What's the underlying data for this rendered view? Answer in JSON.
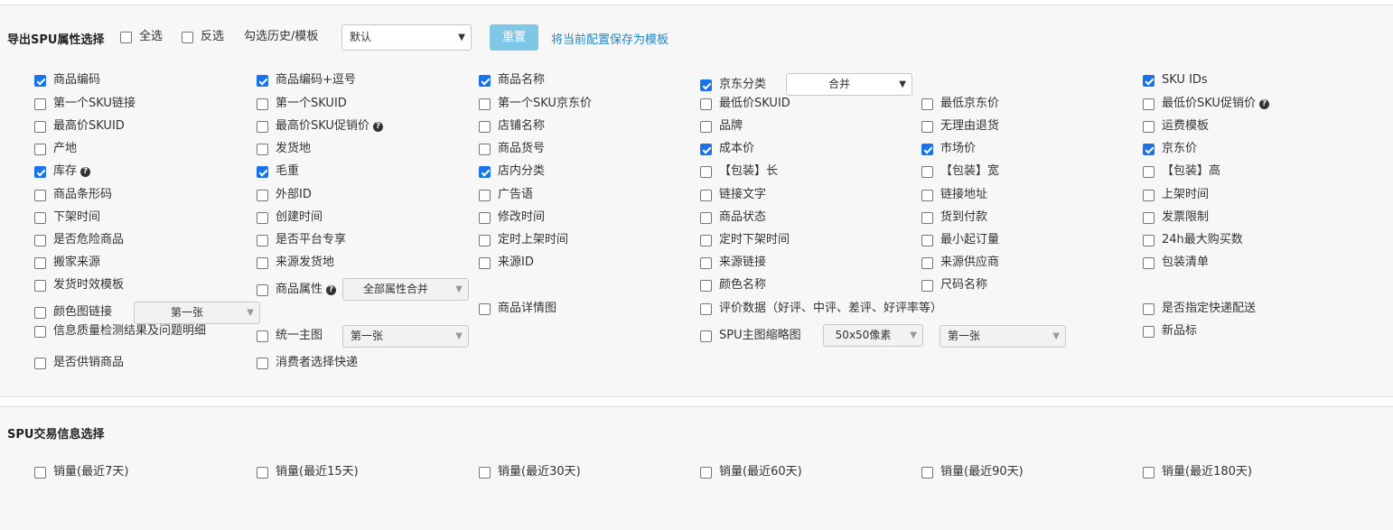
{
  "section1": {
    "title": "导出SPU属性选择",
    "select_all": "全选",
    "invert": "反选",
    "history_label": "勾选历史/模板",
    "template_value": "默认",
    "reset": "重置",
    "save_template": "将当前配置保存为模板",
    "items": [
      {
        "label": "商品编码",
        "checked": true
      },
      {
        "label": "商品编码+逗号",
        "checked": true
      },
      {
        "label": "商品名称",
        "checked": true
      },
      {
        "label": "京东分类",
        "checked": true
      },
      {
        "label": "SKU IDs",
        "checked": true
      },
      {
        "label": "第一个SKU链接",
        "checked": false
      },
      {
        "label": "第一个SKUID",
        "checked": false
      },
      {
        "label": "第一个SKU京东价",
        "checked": false
      },
      {
        "label": "最低价SKUID",
        "checked": false
      },
      {
        "label": "最低京东价",
        "checked": false
      },
      {
        "label": "最低价SKU促销价",
        "checked": false,
        "help": true
      },
      {
        "label": "最高价SKUID",
        "checked": false
      },
      {
        "label": "最高价SKU促销价",
        "checked": false,
        "help": true
      },
      {
        "label": "店铺名称",
        "checked": false
      },
      {
        "label": "品牌",
        "checked": false
      },
      {
        "label": "无理由退货",
        "checked": false
      },
      {
        "label": "运费模板",
        "checked": false
      },
      {
        "label": "产地",
        "checked": false
      },
      {
        "label": "发货地",
        "checked": false
      },
      {
        "label": "商品货号",
        "checked": false
      },
      {
        "label": "成本价",
        "checked": true
      },
      {
        "label": "市场价",
        "checked": true
      },
      {
        "label": "京东价",
        "checked": true
      },
      {
        "label": "库存",
        "checked": true,
        "help": true
      },
      {
        "label": "毛重",
        "checked": true
      },
      {
        "label": "店内分类",
        "checked": true
      },
      {
        "label": "【包装】长",
        "checked": false
      },
      {
        "label": "【包装】宽",
        "checked": false
      },
      {
        "label": "【包装】高",
        "checked": false
      },
      {
        "label": "商品条形码",
        "checked": false
      },
      {
        "label": "外部ID",
        "checked": false
      },
      {
        "label": "广告语",
        "checked": false
      },
      {
        "label": "链接文字",
        "checked": false
      },
      {
        "label": "链接地址",
        "checked": false
      },
      {
        "label": "上架时间",
        "checked": false
      },
      {
        "label": "下架时间",
        "checked": false
      },
      {
        "label": "创建时间",
        "checked": false
      },
      {
        "label": "修改时间",
        "checked": false
      },
      {
        "label": "商品状态",
        "checked": false
      },
      {
        "label": "货到付款",
        "checked": false
      },
      {
        "label": "发票限制",
        "checked": false
      },
      {
        "label": "是否危险商品",
        "checked": false
      },
      {
        "label": "是否平台专享",
        "checked": false
      },
      {
        "label": "定时上架时间",
        "checked": false
      },
      {
        "label": "定时下架时间",
        "checked": false
      },
      {
        "label": "最小起订量",
        "checked": false
      },
      {
        "label": "24h最大购买数",
        "checked": false
      },
      {
        "label": "搬家来源",
        "checked": false
      },
      {
        "label": "来源发货地",
        "checked": false
      },
      {
        "label": "来源ID",
        "checked": false
      },
      {
        "label": "来源链接",
        "checked": false
      },
      {
        "label": "来源供应商",
        "checked": false
      },
      {
        "label": "包装清单",
        "checked": false
      },
      {
        "label": "发货时效模板",
        "checked": false
      },
      {
        "label": "商品属性",
        "checked": false,
        "help": true
      },
      {
        "label": "颜色名称",
        "checked": false
      },
      {
        "label": "尺码名称",
        "checked": false
      },
      {
        "label": "颜色图链接",
        "checked": false
      },
      {
        "label": "商品详情图",
        "checked": false
      },
      {
        "label": "评价数据（好评、中评、差评、好评率等）",
        "checked": false
      },
      {
        "label": "是否指定快递配送",
        "checked": false
      },
      {
        "label": "信息质量检测结果及问题明细",
        "checked": false
      },
      {
        "label": "统一主图",
        "checked": false
      },
      {
        "label": "SPU主图缩略图",
        "checked": false
      },
      {
        "label": "新品标",
        "checked": false
      },
      {
        "label": "是否供销商品",
        "checked": false
      },
      {
        "label": "消费者选择快递",
        "checked": false
      }
    ],
    "selects": {
      "jd_category": "合并",
      "attr_merge": "全部属性合并",
      "color_img": "第一张",
      "main_img": "第一张",
      "thumb_size": "50x50像素",
      "thumb_which": "第一张"
    }
  },
  "section2": {
    "title": "SPU交易信息选择",
    "items": [
      {
        "label": "销量(最近7天)",
        "checked": false
      },
      {
        "label": "销量(最近15天)",
        "checked": false
      },
      {
        "label": "销量(最近30天)",
        "checked": false
      },
      {
        "label": "销量(最近60天)",
        "checked": false
      },
      {
        "label": "销量(最近90天)",
        "checked": false
      },
      {
        "label": "销量(最近180天)",
        "checked": false
      }
    ]
  },
  "icons": {
    "help": "question-circle-icon",
    "dropdown": "chevron-down-icon",
    "checkbox_checked_color": "#1a73e8"
  }
}
